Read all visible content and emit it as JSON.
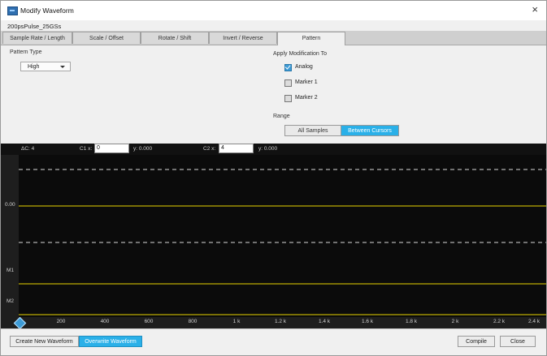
{
  "window": {
    "title": "Modify Waveform"
  },
  "waveform_name": "200psPulse_25GSs",
  "tabs": [
    "Sample Rate / Length",
    "Scale / Offset",
    "Rotate / Shift",
    "Invert / Reverse",
    "Pattern"
  ],
  "active_tab": "Pattern",
  "pattern": {
    "type_label": "Pattern Type",
    "type_value": "High",
    "apply_label": "Apply Modification To",
    "apply_options": [
      {
        "label": "Analog",
        "checked": true
      },
      {
        "label": "Marker 1",
        "checked": false
      },
      {
        "label": "Marker 2",
        "checked": false
      }
    ],
    "range_label": "Range",
    "range_options": [
      "All Samples",
      "Between Cursors"
    ],
    "range_selected": "Between Cursors"
  },
  "cursors": {
    "delta": "ΔC: 4",
    "c1_label": "C1 x:",
    "c1_x": "0",
    "c1_y": "y: 0.000",
    "c2_label": "C2 x:",
    "c2_x": "4",
    "c2_y": "y: 0.000"
  },
  "plot": {
    "y_labels": [
      "0.00",
      "M1",
      "M2"
    ],
    "x_ticks": [
      "200",
      "400",
      "600",
      "800",
      "1 k",
      "1.2 k",
      "1.4 k",
      "1.6 k",
      "1.8 k",
      "2 k",
      "2.2 k",
      "2.4 k"
    ],
    "analog_color": "#e8d400",
    "dash_color": "#d8d8d8"
  },
  "footer": {
    "create_label": "Create New Waveform",
    "overwrite_label": "Overwrite Waveform",
    "compile_label": "Compile",
    "close_label": "Close"
  }
}
